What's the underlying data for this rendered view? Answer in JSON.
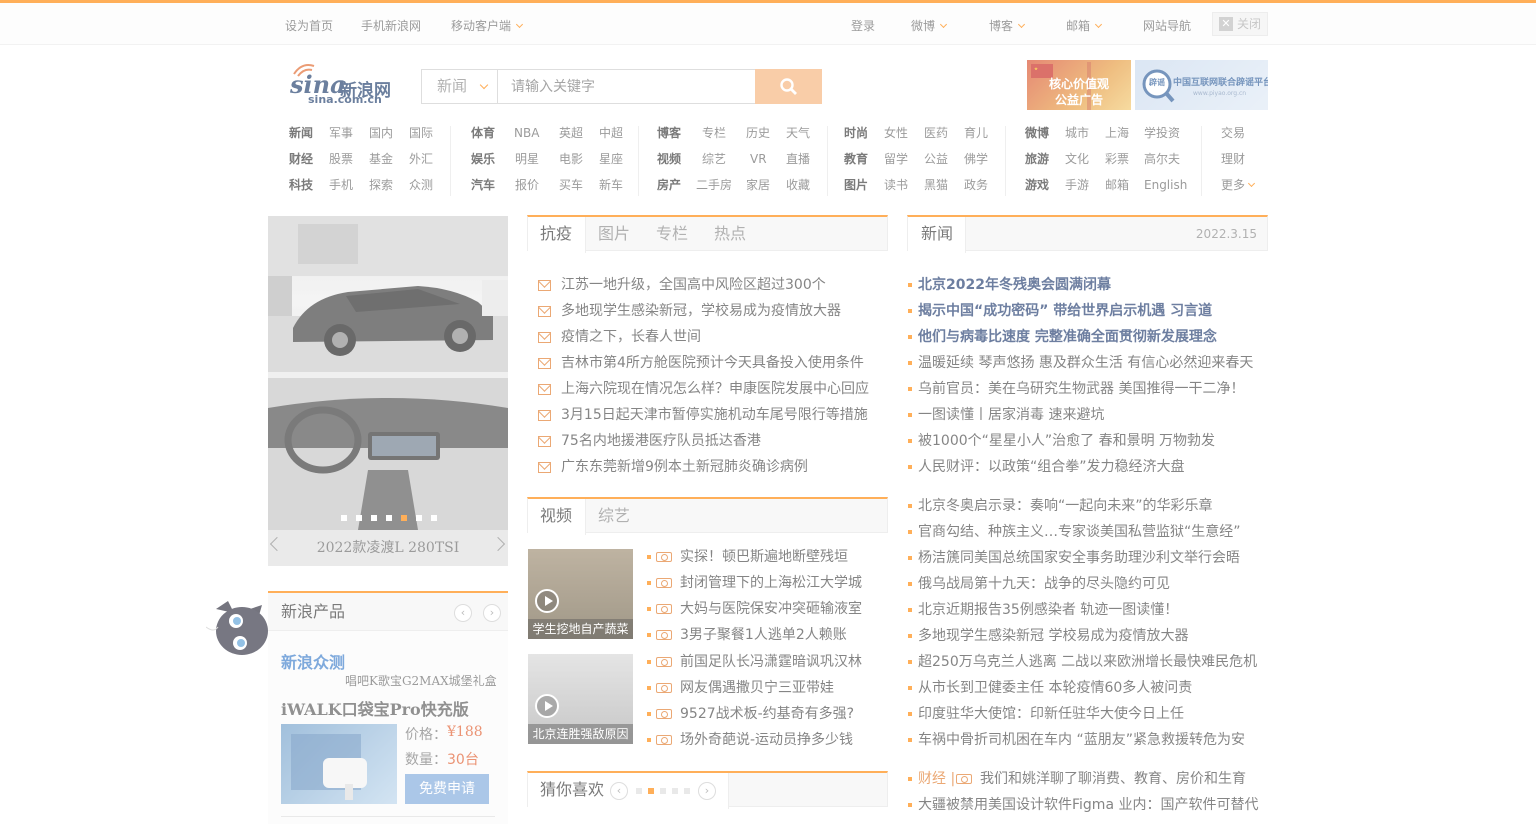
{
  "topbar": {
    "left": [
      "设为首页",
      "手机新浪网",
      "移动客户端"
    ],
    "right": [
      "登录",
      "微博",
      "博客",
      "邮箱",
      "网站导航"
    ],
    "close_label": "关闭"
  },
  "header": {
    "logo_text": "sina",
    "logo_cn": "新浪网",
    "logo_url_text": "sina.com.cn",
    "search_category": "新闻",
    "search_placeholder": "请输入关键字",
    "ad1_text": "核心价值观 公益广告",
    "ad2_text": "中国互联网联合辟谣平台",
    "ad2_sub": "www.piyao.org.cn",
    "ad2_logo": "辟谣"
  },
  "nav": {
    "group1": [
      [
        "新闻",
        "军事",
        "国内",
        "国际"
      ],
      [
        "财经",
        "股票",
        "基金",
        "外汇"
      ],
      [
        "科技",
        "手机",
        "探索",
        "众测"
      ]
    ],
    "group2": [
      [
        "体育",
        "NBA",
        "英超",
        "中超"
      ],
      [
        "娱乐",
        "明星",
        "电影",
        "星座"
      ],
      [
        "汽车",
        "报价",
        "买车",
        "新车"
      ]
    ],
    "group3": [
      [
        "博客",
        "专栏",
        "历史",
        "天气"
      ],
      [
        "视频",
        "综艺",
        "VR",
        "直播"
      ],
      [
        "房产",
        "二手房",
        "家居",
        "收藏"
      ]
    ],
    "group4": [
      [
        "时尚",
        "女性",
        "医药",
        "育儿"
      ],
      [
        "教育",
        "留学",
        "公益",
        "佛学"
      ],
      [
        "图片",
        "读书",
        "黑猫",
        "政务"
      ]
    ],
    "group5": [
      [
        "微博",
        "城市",
        "上海",
        "学投资"
      ],
      [
        "旅游",
        "文化",
        "彩票",
        "高尔夫"
      ],
      [
        "游戏",
        "手游",
        "邮箱",
        "English"
      ]
    ],
    "group6": [
      "交易",
      "理财",
      "更多"
    ]
  },
  "slideshow": {
    "caption": "2022款凌渡L 280TSI",
    "dots_total": 7,
    "active_dot": 5
  },
  "panel1": {
    "tabs": [
      "抗疫",
      "图片",
      "专栏",
      "热点"
    ],
    "items": [
      "江苏一地升级，全国高中风险区超过300个",
      "多地现学生感染新冠，学校易成为疫情放大器",
      "疫情之下，长春人世间",
      "吉林市第4所方舱医院预计今天具备投入使用条件",
      "上海六院现在情况怎么样？申康医院发展中心回应",
      "3月15日起天津市暂停实施机动车尾号限行等措施",
      "75名内地援港医疗队员抵达香港",
      "广东东莞新增9例本土新冠肺炎确诊病例"
    ]
  },
  "panel2": {
    "tabs": [
      "视频",
      "综艺"
    ],
    "thumb1": "学生挖地自产蔬菜",
    "thumb2": "北京连胜强敌原因",
    "items": [
      "实探！顿巴斯遍地断壁残垣",
      "封闭管理下的上海松江大学城",
      "大妈与医院保安冲突砸输液室",
      "3男子聚餐1人逃单2人赖账",
      "前国足队长冯潇霆暗讽巩汉林",
      "网友偶遇撒贝宁三亚带娃",
      "9527战术板-约基奇有多强?",
      "场外奇葩说-运动员挣多少钱"
    ]
  },
  "panel3": {
    "title": "猜你喜欢"
  },
  "news": {
    "tab": "新闻",
    "date": "2022.3.15",
    "headlines": [
      "北京2022年冬残奥会圆满闭幕",
      "揭示中国“成功密码” 带给世界启示机遇 习言道",
      "他们与病毒比速度 完整准确全面贯彻新发展理念"
    ],
    "items1": [
      "温暖延续 琴声悠扬 惠及群众生活 有信心必然迎来春天",
      "乌前官员：美在乌研究生物武器 美国推得一干二净！",
      "一图读懂丨居家消毒 速来避坑",
      "被1000个“星星小人”治愈了 春和景明 万物勃发",
      "人民财评：以政策“组合拳”发力稳经济大盘"
    ],
    "items2": [
      "北京冬奥启示录：奏响“一起向未来”的华彩乐章",
      "官商勾结、种族主义…专家谈美国私营监狱“生意经”",
      "杨洁篪同美国总统国家安全事务助理沙利文举行会晤",
      "俄乌战局第十九天：战争的尽头隐约可见",
      "北京近期报告35例感染者 轨迹一图读懂！",
      "多地现学生感染新冠 学校易成为疫情放大器",
      "超250万乌克兰人逃离 二战以来欧洲增长最快难民危机",
      "从市长到卫健委主任 本轮疫情60多人被问责",
      "印度驻华大使馆：印新任驻华大使今日上任",
      "车祸中骨折司机困在车内 “蓝朋友”紧急救援转危为安"
    ],
    "finance_label": "财经 |",
    "finance_item": "我们和姚洋聊了聊消费、教育、房价和生育",
    "last_item": "大疆被禁用美国设计软件Figma 业内：国产软件可替代"
  },
  "products": {
    "title": "新浪产品",
    "sub_title": "新浪众测",
    "promo": "唱吧K歌宝G2MAX城堡礼盒",
    "item_name": "iWALK口袋宝Pro快充版",
    "price_label": "价格：",
    "price": "¥188",
    "qty_label": "数量：",
    "qty": "30台",
    "apply_btn": "免费申请"
  }
}
